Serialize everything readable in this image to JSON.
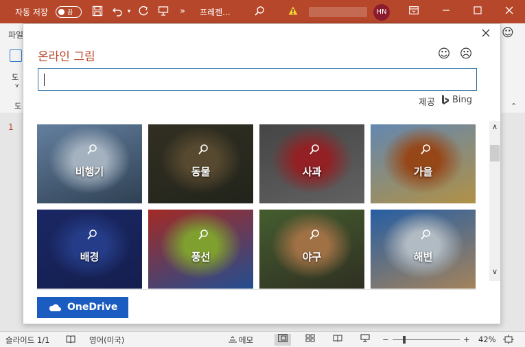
{
  "titlebar": {
    "autosave_label": "자동 저장",
    "autosave_state": "끔",
    "file_name": "프레젠...",
    "user_initials": "HN",
    "more_symbol": "»"
  },
  "ribbon": {
    "file_tab": "파일",
    "left_label_1": "도",
    "left_label_2": "v",
    "left_label_3": "도"
  },
  "slide": {
    "number": "1"
  },
  "dialog": {
    "title": "온라인 그림",
    "search_value": "",
    "provider_label": "제공",
    "provider_name": "Bing",
    "categories": [
      {
        "label": "비행기",
        "colors": [
          "#7a9cc2",
          "#c9d9ea",
          "#3a4f66"
        ]
      },
      {
        "label": "동물",
        "colors": [
          "#3d3a2a",
          "#6b5a3a",
          "#2a2c22"
        ]
      },
      {
        "label": "사과",
        "colors": [
          "#555555",
          "#b3282c",
          "#777777"
        ]
      },
      {
        "label": "가을",
        "colors": [
          "#7aa6d8",
          "#b8571e",
          "#d8b155"
        ]
      },
      {
        "label": "배경",
        "colors": [
          "#20307a",
          "#2e4aa6",
          "#1a2660"
        ]
      },
      {
        "label": "풍선",
        "colors": [
          "#c7342e",
          "#9bc43a",
          "#2c5fb0"
        ]
      },
      {
        "label": "야구",
        "colors": [
          "#54723a",
          "#c48a55",
          "#3a3a2a"
        ]
      },
      {
        "label": "해변",
        "colors": [
          "#2f74c8",
          "#d8e4ee",
          "#c8a070"
        ]
      }
    ],
    "onedrive_label": "OneDrive"
  },
  "statusbar": {
    "slide_info": "슬라이드 1/1",
    "language": "영어(미국)",
    "notes": "메모",
    "zoom_minus": "−",
    "zoom_plus": "+",
    "zoom_level": "42%"
  }
}
